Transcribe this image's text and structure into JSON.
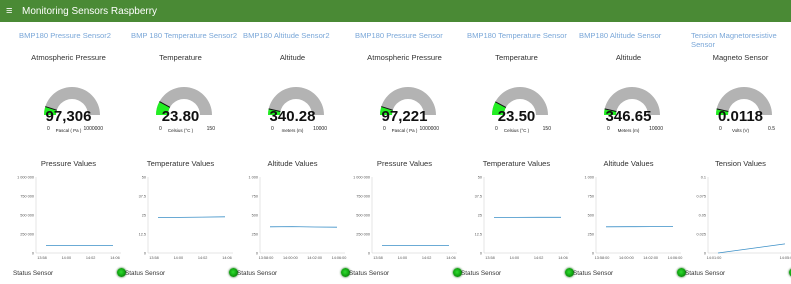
{
  "app": {
    "title": "Monitoring Sensors Raspberry"
  },
  "columns": [
    {
      "tab": "BMP180 Pressure Sensor2",
      "gauge": {
        "title": "Atmospheric Pressure",
        "value_text": "97,306",
        "value": 97306,
        "min": "0",
        "max": "1000000",
        "unit": "Pascal ( Pa )"
      },
      "chart": {
        "title": "Pressure Values",
        "yticks": [
          "1 000 000",
          "750 000",
          "500 000",
          "250 000",
          "0"
        ],
        "xticks": [
          "13:58",
          "14:00",
          "14:02",
          "14:06"
        ]
      },
      "status_label": "Status Sensor"
    },
    {
      "tab": "BMP 180 Temperature Sensor2",
      "gauge": {
        "title": "Temperature",
        "value_text": "23.80",
        "value": 23.8,
        "min": "0",
        "max": "150",
        "unit": "Celsius (°C )"
      },
      "chart": {
        "title": "Temperature Values",
        "yticks": [
          "50",
          "37.5",
          "25",
          "12.5",
          "0"
        ],
        "xticks": [
          "13:58",
          "14:00",
          "14:02",
          "14:06"
        ]
      },
      "status_label": "Status Sensor"
    },
    {
      "tab": "BMP180 Altitude Sensor2",
      "gauge": {
        "title": "Altitude",
        "value_text": "340.28",
        "value": 340.28,
        "min": "0",
        "max": "10000",
        "unit": "meters (m)"
      },
      "chart": {
        "title": "Altitude Values",
        "yticks": [
          "1 000",
          "750",
          "500",
          "250",
          "0"
        ],
        "xticks": [
          "13:58:00",
          "14:00:00",
          "14:02:00",
          "14:06:00"
        ]
      },
      "status_label": "Status Sensor"
    },
    {
      "tab": "BMP180 Pressure Sensor",
      "gauge": {
        "title": "Atmospheric Pressure",
        "value_text": "97,221",
        "value": 97221,
        "min": "0",
        "max": "1000000",
        "unit": "Pascal ( Pa )"
      },
      "chart": {
        "title": "Pressure Values",
        "yticks": [
          "1 000 000",
          "750 000",
          "500 000",
          "250 000",
          "0"
        ],
        "xticks": [
          "13:58",
          "14:00",
          "14:02",
          "14:06"
        ]
      },
      "status_label": "Status Sensor"
    },
    {
      "tab": "BMP180 Temperature Sensor",
      "gauge": {
        "title": "Temperature",
        "value_text": "23.50",
        "value": 23.5,
        "min": "0",
        "max": "150",
        "unit": "Celsius (°C )"
      },
      "chart": {
        "title": "Temperature Values",
        "yticks": [
          "50",
          "37.5",
          "25",
          "12.5",
          "0"
        ],
        "xticks": [
          "13:58",
          "14:00",
          "14:02",
          "14:06"
        ]
      },
      "status_label": "Status Sensor"
    },
    {
      "tab": "BMP180 Altitude Sensor",
      "gauge": {
        "title": "Altitude",
        "value_text": "346.65",
        "value": 346.65,
        "min": "0",
        "max": "10000",
        "unit": "Meters (m)"
      },
      "chart": {
        "title": "Altitude Values",
        "yticks": [
          "1 000",
          "750",
          "500",
          "250",
          "0"
        ],
        "xticks": [
          "13:58:00",
          "14:00:00",
          "14:02:00",
          "14:06:00"
        ]
      },
      "status_label": "Status Sensor"
    },
    {
      "tab": "Tension Magnetoresistive Sensor",
      "gauge": {
        "title": "Magneto Sensor",
        "value_text": "0.0118",
        "value": 0.0118,
        "min": "0",
        "max": "0.5",
        "unit": "Volts (V)"
      },
      "chart": {
        "title": "Tension Values",
        "yticks": [
          "0.1",
          "0.075",
          "0.05",
          "0.025",
          "0"
        ],
        "xticks": [
          "14:01:00",
          "14:05:00"
        ]
      },
      "status_label": "Status Sensor"
    }
  ],
  "colors": {
    "header": "#4a8a35",
    "tab_text": "#7aa7d8",
    "gauge_track": "#b3b3b3",
    "gauge_fill": "#22ee22",
    "series_line": "#3a8fc7",
    "status_led": "#12a012"
  },
  "chart_data": [
    {
      "type": "line",
      "title": "Pressure Values",
      "x": [
        "13:58",
        "14:00",
        "14:02",
        "14:06"
      ],
      "series": [
        {
          "values": [
            97300,
            97300,
            97310,
            97306
          ]
        }
      ],
      "ylim": [
        0,
        1000000
      ]
    },
    {
      "type": "line",
      "title": "Temperature Values",
      "x": [
        "13:58",
        "14:00",
        "14:02",
        "14:06"
      ],
      "series": [
        {
          "values": [
            23.3,
            23.4,
            23.6,
            23.8
          ]
        }
      ],
      "ylim": [
        0,
        50
      ]
    },
    {
      "type": "line",
      "title": "Altitude Values",
      "x": [
        "13:58:00",
        "14:00:00",
        "14:02:00",
        "14:06:00"
      ],
      "series": [
        {
          "values": [
            345,
            348,
            342,
            340
          ]
        }
      ],
      "ylim": [
        0,
        1000
      ]
    },
    {
      "type": "line",
      "title": "Pressure Values",
      "x": [
        "13:58",
        "14:00",
        "14:02",
        "14:06"
      ],
      "series": [
        {
          "values": [
            97220,
            97222,
            97221,
            97221
          ]
        }
      ],
      "ylim": [
        0,
        1000000
      ]
    },
    {
      "type": "line",
      "title": "Temperature Values",
      "x": [
        "13:58",
        "14:00",
        "14:02",
        "14:06"
      ],
      "series": [
        {
          "values": [
            23.4,
            23.4,
            23.5,
            23.5
          ]
        }
      ],
      "ylim": [
        0,
        50
      ]
    },
    {
      "type": "line",
      "title": "Altitude Values",
      "x": [
        "13:58:00",
        "14:00:00",
        "14:02:00",
        "14:06:00"
      ],
      "series": [
        {
          "values": [
            345,
            346,
            347,
            347
          ]
        }
      ],
      "ylim": [
        0,
        1000
      ]
    },
    {
      "type": "line",
      "title": "Tension Values",
      "x": [
        "14:01:00",
        "14:05:00"
      ],
      "series": [
        {
          "values": [
            0.0,
            0.012
          ]
        }
      ],
      "ylim": [
        0,
        0.1
      ]
    }
  ]
}
